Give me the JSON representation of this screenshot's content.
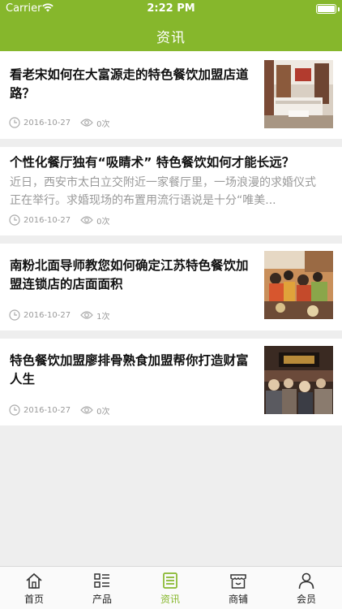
{
  "status_bar": {
    "carrier": "Carrier",
    "time": "2:22 PM"
  },
  "nav": {
    "title": "资讯"
  },
  "articles": [
    {
      "title_line1": "看老宋如何在大富源走的特色餐饮加盟店道",
      "title_line2": "路？",
      "summary": "",
      "date": "2016-10-27",
      "views": "0次",
      "has_thumbnail": true
    },
    {
      "title_line1": "个性化餐厅独有“吸睛术” 特色餐饮如何才能长远？",
      "title_line2": "",
      "summary_line1": "近日，西安市太白立交附近一家餐厅里，一场浪漫的求婚仪式",
      "summary_line2": "正在举行。求婚现场的布置用流行语说是十分“唯美...",
      "date": "2016-10-27",
      "views": "0次",
      "has_thumbnail": false
    },
    {
      "title_line1": "南粉北面导师教您如何确定江苏特色餐饮加",
      "title_line2": "盟连锁店的店面面积",
      "summary": "",
      "date": "2016-10-27",
      "views": "1次",
      "has_thumbnail": true
    },
    {
      "title_line1": "特色餐饮加盟廖排骨熟食加盟帮你打造财富",
      "title_line2": "人生",
      "summary": "",
      "date": "2016-10-27",
      "views": "0次",
      "has_thumbnail": true
    }
  ],
  "tabbar": {
    "items": [
      {
        "label": "首页",
        "icon": "home-icon"
      },
      {
        "label": "产品",
        "icon": "list-icon"
      },
      {
        "label": "资讯",
        "icon": "news-icon",
        "active": true
      },
      {
        "label": "商铺",
        "icon": "store-icon"
      },
      {
        "label": "会员",
        "icon": "user-icon"
      }
    ]
  },
  "colors": {
    "accent": "#86b72c",
    "background": "#eeeeee",
    "meta_text": "#9a9a9a"
  }
}
